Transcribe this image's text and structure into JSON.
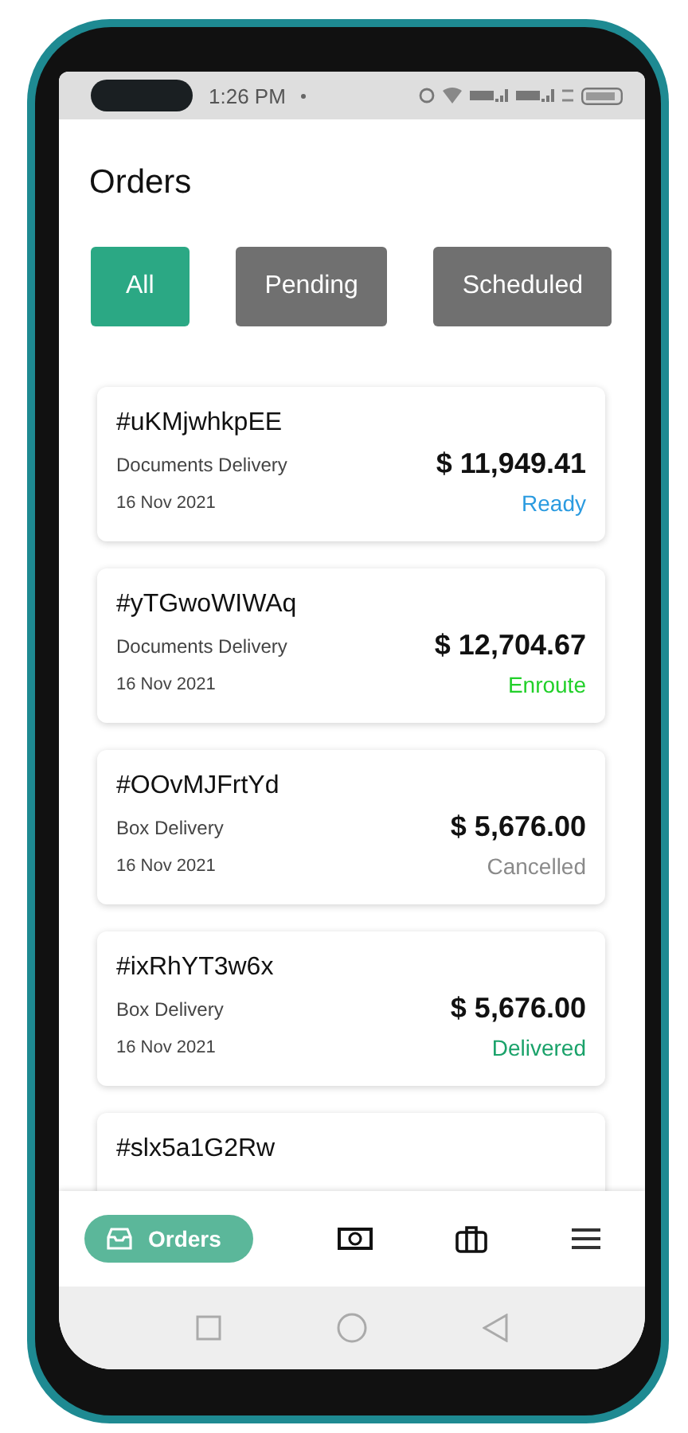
{
  "status_bar": {
    "time": "1:26 PM"
  },
  "title": "Orders",
  "filters": [
    {
      "label": "All",
      "selected": true
    },
    {
      "label": "Pending",
      "selected": false
    },
    {
      "label": "Scheduled",
      "selected": false
    }
  ],
  "orders": [
    {
      "id": "#uKMjwhkpEE",
      "type": "Documents Delivery",
      "date": "16 Nov 2021",
      "amount": "$ 11,949.41",
      "status": "Ready",
      "color": "#2b9be0"
    },
    {
      "id": "#yTGwoWIWAq",
      "type": "Documents Delivery",
      "date": "16 Nov 2021",
      "amount": "$ 12,704.67",
      "status": "Enroute",
      "color": "#22d02a"
    },
    {
      "id": "#OOvMJFrtYd",
      "type": "Box Delivery",
      "date": "16 Nov 2021",
      "amount": "$ 5,676.00",
      "status": "Cancelled",
      "color": "#8a8a8a"
    },
    {
      "id": "#ixRhYT3w6x",
      "type": "Box Delivery",
      "date": "16 Nov 2021",
      "amount": "$ 5,676.00",
      "status": "Delivered",
      "color": "#1aa26a"
    },
    {
      "id": "#slx5a1G2Rw"
    }
  ],
  "bottom_nav": [
    {
      "kind": "orders",
      "label": "Orders",
      "selected": true
    },
    {
      "kind": "money",
      "selected": false
    },
    {
      "kind": "bag",
      "selected": false
    },
    {
      "kind": "menu",
      "selected": false
    }
  ]
}
